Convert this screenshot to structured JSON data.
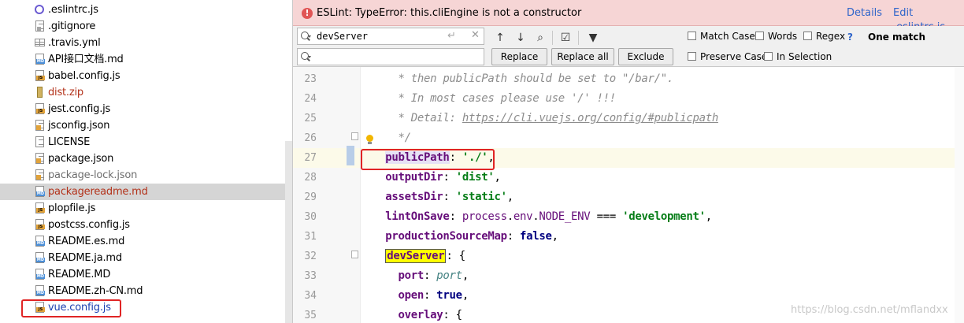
{
  "project_tree": {
    "files": [
      {
        "label": ".eslintrc.js",
        "icon": "eslint-config-icon",
        "color": "default"
      },
      {
        "label": ".gitignore",
        "icon": "gitignore-file-icon",
        "color": "default"
      },
      {
        "label": ".travis.yml",
        "icon": "yaml-file-icon",
        "color": "default"
      },
      {
        "label": "API接口文档.md",
        "icon": "markdown-file-icon",
        "color": "default"
      },
      {
        "label": "babel.config.js",
        "icon": "js-file-icon",
        "color": "default"
      },
      {
        "label": "dist.zip",
        "icon": "zip-file-icon",
        "color": "red"
      },
      {
        "label": "jest.config.js",
        "icon": "js-file-icon",
        "color": "default"
      },
      {
        "label": "jsconfig.json",
        "icon": "json-file-icon",
        "color": "default"
      },
      {
        "label": "LICENSE",
        "icon": "text-file-icon",
        "color": "default"
      },
      {
        "label": "package.json",
        "icon": "json-file-icon",
        "color": "default"
      },
      {
        "label": "package-lock.json",
        "icon": "json-file-icon",
        "color": "gray"
      },
      {
        "label": "packagereadme.md",
        "icon": "markdown-file-icon",
        "color": "red",
        "selected": true
      },
      {
        "label": "plopfile.js",
        "icon": "js-file-icon",
        "color": "default"
      },
      {
        "label": "postcss.config.js",
        "icon": "js-file-icon",
        "color": "default"
      },
      {
        "label": "README.es.md",
        "icon": "markdown-file-icon",
        "color": "default"
      },
      {
        "label": "README.ja.md",
        "icon": "markdown-file-icon",
        "color": "default"
      },
      {
        "label": "README.MD",
        "icon": "markdown-file-icon",
        "color": "default"
      },
      {
        "label": "README.zh-CN.md",
        "icon": "markdown-file-icon",
        "color": "default"
      },
      {
        "label": "vue.config.js",
        "icon": "js-file-icon",
        "color": "blue",
        "highlighted": true
      }
    ],
    "colors": {
      "red": "#b3321a",
      "gray": "#6e6e6e",
      "blue": "#1a3fb0",
      "selected_bg": "#d5d5d5"
    }
  },
  "eslint_banner": {
    "message": "ESLint: TypeError: this.cliEngine is not a constructor",
    "details_link": "Details",
    "edit_link": "Edit .eslintrc.js",
    "background": "#f6d5d5"
  },
  "find_bar": {
    "search_value": "devServer",
    "replace_value": "",
    "buttons": {
      "replace": "Replace",
      "replace_all": "Replace all",
      "exclude": "Exclude"
    },
    "options": {
      "match_case": "Match Case",
      "words": "Words",
      "regex": "Regex",
      "regex_help": "?",
      "preserve_case": "Preserve Case",
      "in_selection": "In Selection"
    },
    "match_status": "One match"
  },
  "editor": {
    "current_line": 27,
    "lines": [
      {
        "no": "23",
        "tokens": [
          {
            "t": "    * then publicPath should be set to \"/bar/\".",
            "c": "comment"
          }
        ]
      },
      {
        "no": "24",
        "tokens": [
          {
            "t": "    * In most cases please use '/' !!!",
            "c": "comment"
          }
        ]
      },
      {
        "no": "25",
        "tokens": [
          {
            "t": "    * Detail: ",
            "c": "comment"
          },
          {
            "t": "https://cli.vuejs.org/config/#publicpath",
            "c": "link"
          }
        ]
      },
      {
        "no": "26",
        "tokens": [
          {
            "t": "    */",
            "c": "comment"
          }
        ]
      },
      {
        "no": "27",
        "tokens": [
          {
            "t": "  ",
            "c": "plain"
          },
          {
            "t": "publicPath",
            "c": "key cursor-hl"
          },
          {
            "t": ": ",
            "c": "plain"
          },
          {
            "t": "'./'",
            "c": "str"
          },
          {
            "t": ",",
            "c": "plain"
          }
        ]
      },
      {
        "no": "28",
        "tokens": [
          {
            "t": "  ",
            "c": "plain"
          },
          {
            "t": "outputDir",
            "c": "key"
          },
          {
            "t": ": ",
            "c": "plain"
          },
          {
            "t": "'dist'",
            "c": "str"
          },
          {
            "t": ",",
            "c": "plain"
          }
        ]
      },
      {
        "no": "29",
        "tokens": [
          {
            "t": "  ",
            "c": "plain"
          },
          {
            "t": "assetsDir",
            "c": "key"
          },
          {
            "t": ": ",
            "c": "plain"
          },
          {
            "t": "'static'",
            "c": "str"
          },
          {
            "t": ",",
            "c": "plain"
          }
        ]
      },
      {
        "no": "30",
        "tokens": [
          {
            "t": "  ",
            "c": "plain"
          },
          {
            "t": "lintOnSave",
            "c": "key"
          },
          {
            "t": ": ",
            "c": "plain"
          },
          {
            "t": "process",
            "c": "var"
          },
          {
            "t": ".",
            "c": "plain"
          },
          {
            "t": "env",
            "c": "var"
          },
          {
            "t": ".",
            "c": "plain"
          },
          {
            "t": "NODE_ENV",
            "c": "var"
          },
          {
            "t": " === ",
            "c": "plain"
          },
          {
            "t": "'development'",
            "c": "str"
          },
          {
            "t": ",",
            "c": "plain"
          }
        ]
      },
      {
        "no": "31",
        "tokens": [
          {
            "t": "  ",
            "c": "plain"
          },
          {
            "t": "productionSourceMap",
            "c": "key"
          },
          {
            "t": ": ",
            "c": "plain"
          },
          {
            "t": "false",
            "c": "kw"
          },
          {
            "t": ",",
            "c": "plain"
          }
        ]
      },
      {
        "no": "32",
        "tokens": [
          {
            "t": "  ",
            "c": "plain"
          },
          {
            "t": "devServer",
            "c": "key match"
          },
          {
            "t": ": {",
            "c": "plain"
          }
        ]
      },
      {
        "no": "33",
        "tokens": [
          {
            "t": "    ",
            "c": "plain"
          },
          {
            "t": "port",
            "c": "key"
          },
          {
            "t": ": ",
            "c": "plain"
          },
          {
            "t": "port",
            "c": "id"
          },
          {
            "t": ",",
            "c": "plain"
          }
        ]
      },
      {
        "no": "34",
        "tokens": [
          {
            "t": "    ",
            "c": "plain"
          },
          {
            "t": "open",
            "c": "key"
          },
          {
            "t": ": ",
            "c": "plain"
          },
          {
            "t": "true",
            "c": "kw"
          },
          {
            "t": ",",
            "c": "plain"
          }
        ]
      },
      {
        "no": "35",
        "tokens": [
          {
            "t": "    ",
            "c": "plain"
          },
          {
            "t": "overlay",
            "c": "key"
          },
          {
            "t": ": {",
            "c": "plain"
          }
        ]
      }
    ]
  },
  "watermark": "https://blog.csdn.net/mflandxx"
}
